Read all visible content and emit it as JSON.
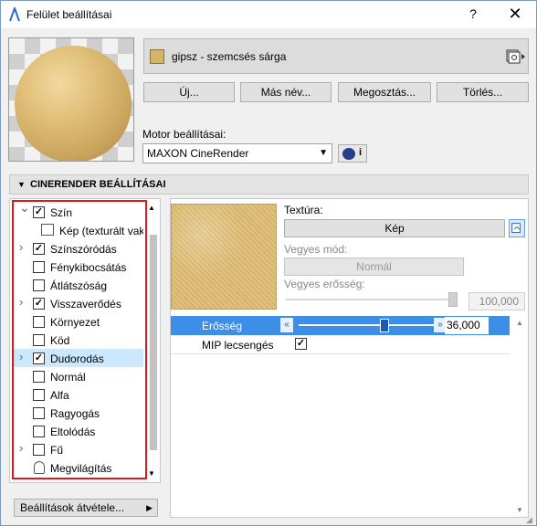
{
  "window": {
    "title": "Felület beállításai",
    "help": "?",
    "close": "✕"
  },
  "material": {
    "name": "gipsz - szemcsés sárga",
    "swatch_color": "#d6b666"
  },
  "buttons": {
    "new": "Új...",
    "rename": "Más név...",
    "share": "Megosztás...",
    "delete": "Törlés..."
  },
  "engine": {
    "label": "Motor beállításai:",
    "selected": "MAXON CineRender",
    "info": "i"
  },
  "section": {
    "title": "CINERENDER BEÁLLÍTÁSAI"
  },
  "tree": {
    "items": [
      {
        "label": "Szín",
        "checked": true,
        "expander": "down"
      },
      {
        "label": "Kép (texturált vakolat)",
        "sub": true
      },
      {
        "label": "Színszóródás",
        "checked": true,
        "expander": "right"
      },
      {
        "label": "Fénykibocsátás",
        "checked": false
      },
      {
        "label": "Átlátszóság",
        "checked": false
      },
      {
        "label": "Visszaverődés",
        "checked": true,
        "expander": "right"
      },
      {
        "label": "Környezet",
        "checked": false
      },
      {
        "label": "Köd",
        "checked": false
      },
      {
        "label": "Dudorodás",
        "checked": true,
        "expander": "right",
        "selected": true
      },
      {
        "label": "Normál",
        "checked": false
      },
      {
        "label": "Alfa",
        "checked": false
      },
      {
        "label": "Ragyogás",
        "checked": false
      },
      {
        "label": "Eltolódás",
        "checked": false
      },
      {
        "label": "Fű",
        "checked": false,
        "expander": "right"
      },
      {
        "label": "Megvilágítás",
        "icon": true
      }
    ]
  },
  "settings_transfer": "Beállítások átvétele...",
  "texture": {
    "label": "Textúra:",
    "button": "Kép",
    "mix_mode_label": "Vegyes mód:",
    "mix_mode_value": "Normál",
    "mix_strength_label": "Vegyes erősség:",
    "mix_strength_value": "100,000",
    "mix_strength_fraction": 1.0
  },
  "params": {
    "strength_label": "Erősség",
    "strength_value": "36,000",
    "strength_fraction": 0.36,
    "mip_label": "MIP lecsengés",
    "mip_checked": true
  }
}
